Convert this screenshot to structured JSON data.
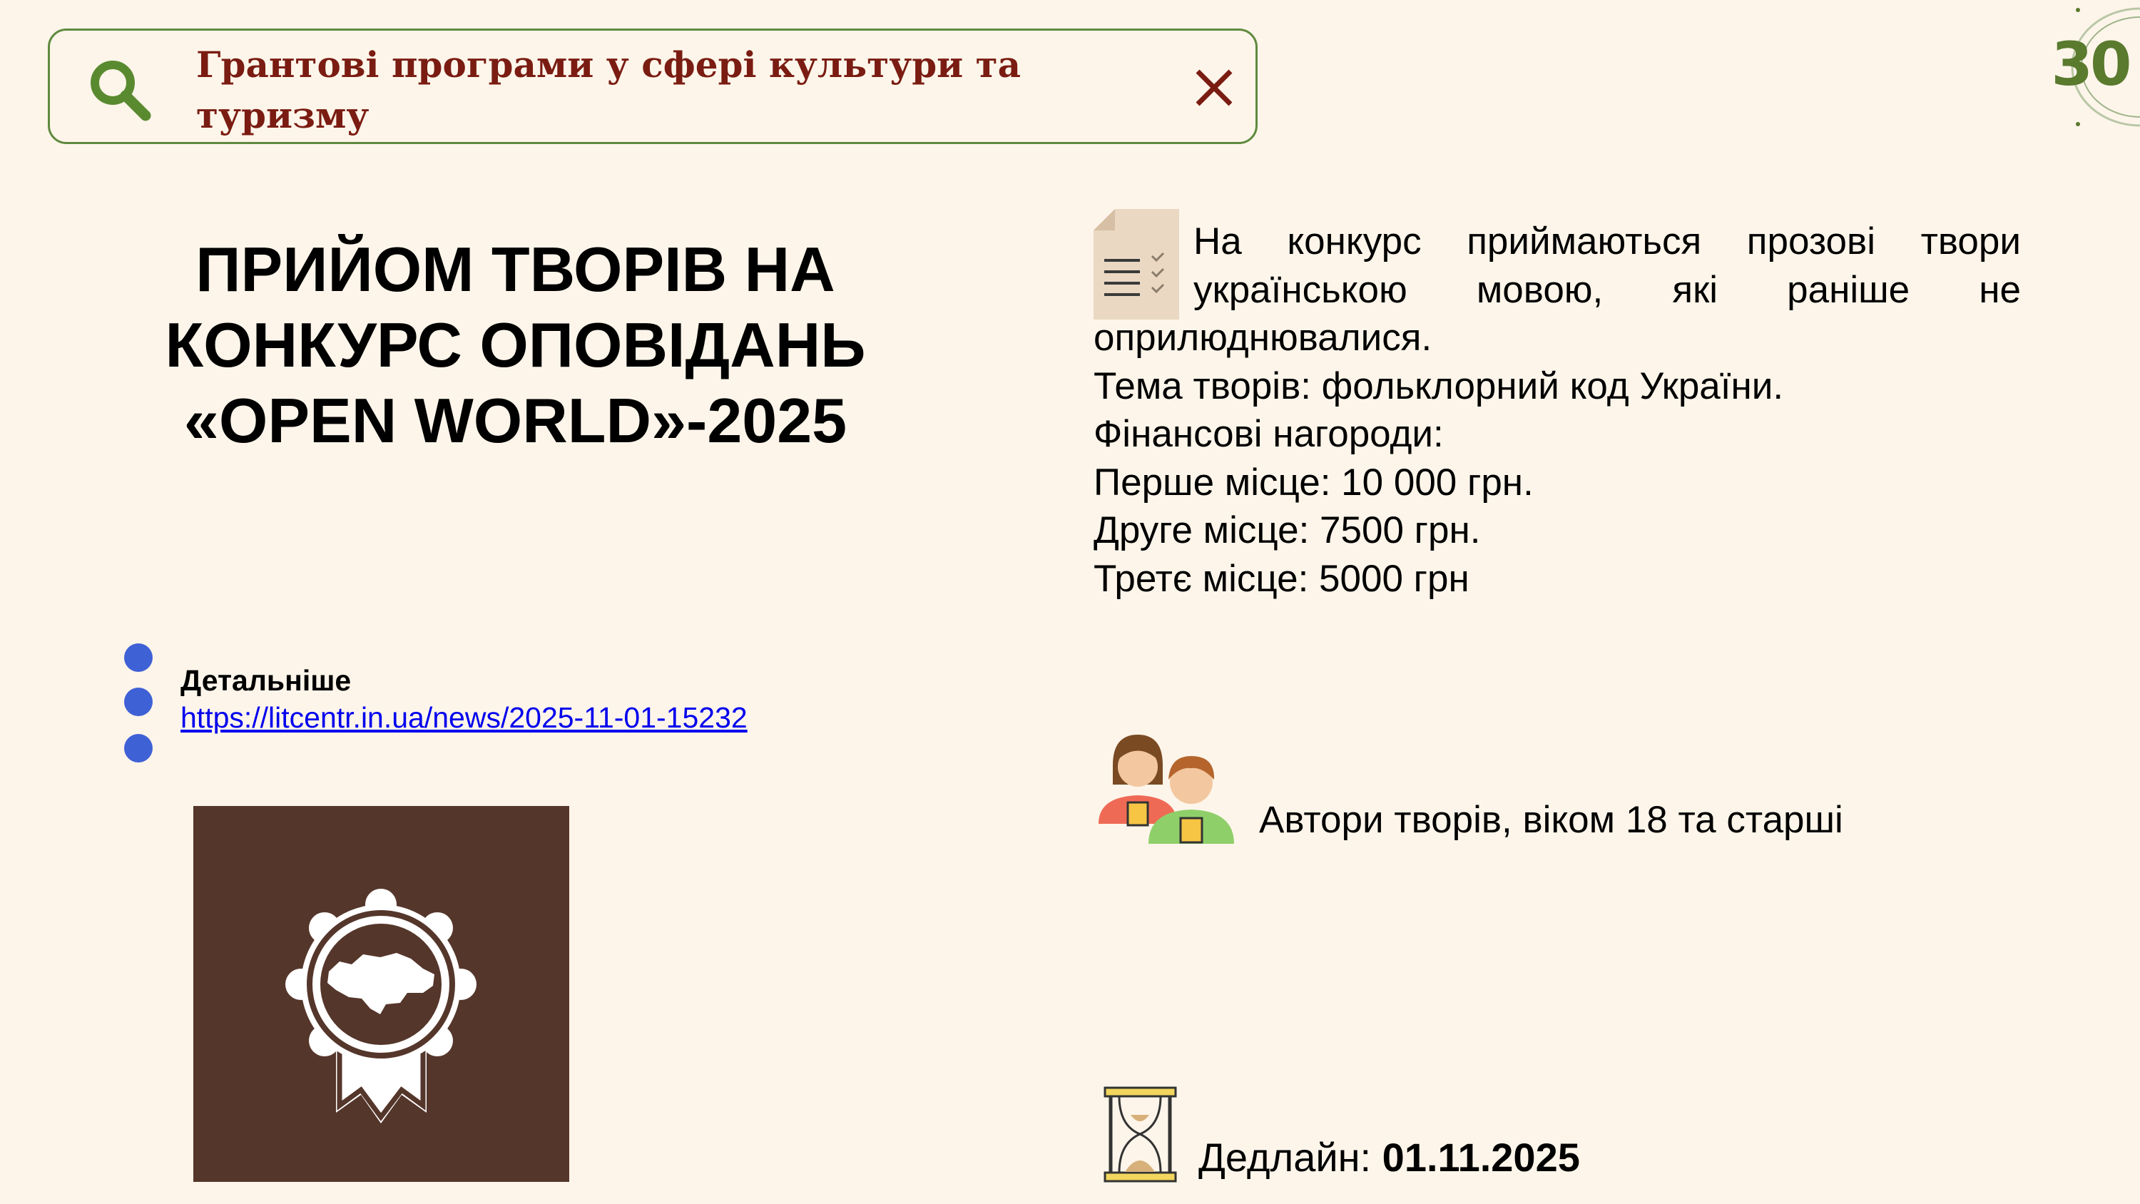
{
  "search": {
    "query_line1": "Грантові програми у сфері культури та",
    "query_line2": "туризму",
    "icon": "search-icon",
    "close_icon": "close-icon"
  },
  "page_number": "30",
  "title": {
    "line1": "ПРИЙОМ ТВОРІВ НА",
    "line2": "КОНКУРС ОПОВІДАНЬ",
    "line3": "«OPEN WORLD»-2025"
  },
  "details": {
    "label": "Детальніше",
    "link": "https://litcentr.in.ua/news/2025-11-01-15232"
  },
  "description": {
    "intro": "На конкурс приймаються прозові твори українською мовою, які раніше не оприлюднювалися.",
    "lines": [
      "Тема творів: фольклорний код України.",
      "Фінансові нагороди:",
      "Перше місце: 10 000 грн.",
      "Друге місце: 7500 грн.",
      "Третє місце: 5000 грн"
    ]
  },
  "authors": "Автори творів, віком 18 та старші",
  "deadline": {
    "label": "Дедлайн: ",
    "date": "01.11.2025"
  },
  "colors": {
    "background": "#fdf5ea",
    "accent_green": "#5f8a3d",
    "search_text": "#7a1c12",
    "bullet": "#3f61d6",
    "image_bg": "#55362b"
  }
}
